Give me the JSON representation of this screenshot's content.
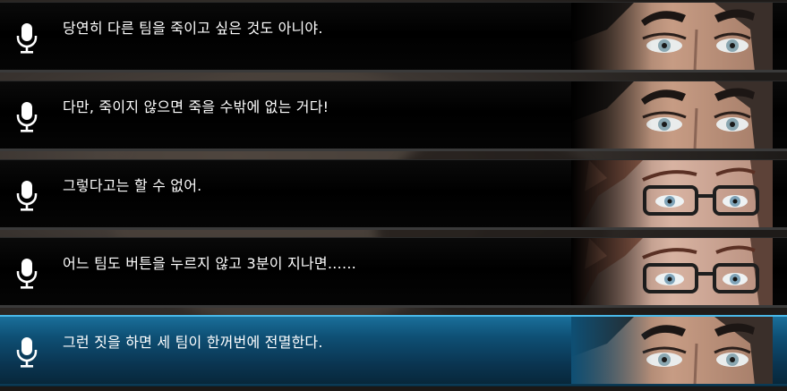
{
  "lines": [
    {
      "speaker": "black-haired-man",
      "text": "당연히 다른 팀을 죽이고 싶은 것도 아니야.",
      "active": false
    },
    {
      "speaker": "black-haired-man",
      "text": "다만, 죽이지 않으면 죽을 수밖에 없는 거다!",
      "active": false
    },
    {
      "speaker": "glasses-man",
      "text": "그렇다고는 할 수 없어.",
      "active": false
    },
    {
      "speaker": "glasses-man",
      "text": "어느 팀도 버튼을 누르지 않고 3분이 지나면……",
      "active": false
    },
    {
      "speaker": "black-haired-man",
      "text": "그런 짓을 하면 세 팀이 한꺼번에 전멸한다.",
      "active": true
    }
  ],
  "colors": {
    "active_row": "#0e4f74",
    "active_border": "#49b8e8",
    "inactive_row": "#000000",
    "text": "#ffffff"
  },
  "icons": {
    "voice": "microphone-icon"
  }
}
